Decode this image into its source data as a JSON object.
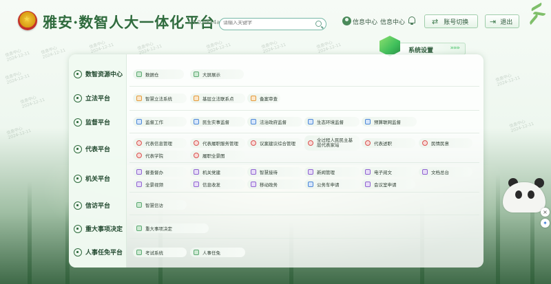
{
  "header": {
    "title": "雅安·数智人大一体化平台",
    "version": "v5.0.0814a",
    "search_placeholder": "请输入关键字",
    "user_link": "信息中心",
    "info_center": "信息中心",
    "switch_account": "账号切换",
    "logout": "退出"
  },
  "system_settings": {
    "label": "系统设置",
    "arrows": "»»»"
  },
  "watermark": {
    "line1": "信息中心",
    "line2": "2024-12-11"
  },
  "rows": [
    {
      "label": "数智资源中心",
      "items": [
        {
          "label": "数据仓",
          "icon": "database-icon",
          "color": "green"
        },
        {
          "label": "大屏展示",
          "icon": "screen-icon",
          "color": "green"
        }
      ]
    },
    {
      "label": "立法平台",
      "items": [
        {
          "label": "智慧立法系统",
          "icon": "legislation-icon",
          "color": "orange"
        },
        {
          "label": "基层立法联系点",
          "icon": "contact-point-icon",
          "color": "orange"
        },
        {
          "label": "备案审查",
          "icon": "review-icon",
          "color": "orange"
        }
      ]
    },
    {
      "label": "监督平台",
      "items": [
        {
          "label": "监督工作",
          "icon": "supervision-icon",
          "color": "blue"
        },
        {
          "label": "民生实事监督",
          "icon": "livelihood-icon",
          "color": "blue"
        },
        {
          "label": "法治政府监督",
          "icon": "rule-of-law-icon",
          "color": "blue"
        },
        {
          "label": "生态环境监督",
          "icon": "ecology-icon",
          "color": "blue"
        },
        {
          "label": "预算联网监督",
          "icon": "budget-icon",
          "color": "blue"
        }
      ]
    },
    {
      "label": "代表平台",
      "items": [
        {
          "label": "代表信息管理",
          "icon": "deputy-info-icon",
          "color": "red"
        },
        {
          "label": "代表履职服务管理",
          "icon": "duty-service-icon",
          "color": "red"
        },
        {
          "label": "议案建议综合管理",
          "icon": "proposal-icon",
          "color": "red"
        },
        {
          "label": "全过程人民民主基层代表家站",
          "icon": "home-station-icon",
          "color": "red"
        },
        {
          "label": "代表述职",
          "icon": "report-icon",
          "color": "red"
        },
        {
          "label": "民情民意",
          "icon": "opinion-icon",
          "color": "red"
        },
        {
          "label": "代表学院",
          "icon": "academy-icon",
          "color": "red"
        },
        {
          "label": "履职全景图",
          "icon": "panorama-icon",
          "color": "red"
        }
      ]
    },
    {
      "label": "机关平台",
      "items": [
        {
          "label": "督查督办",
          "icon": "inspection-icon",
          "color": "purple"
        },
        {
          "label": "机关党建",
          "icon": "party-building-icon",
          "color": "purple"
        },
        {
          "label": "智慧接待",
          "icon": "reception-icon",
          "color": "purple"
        },
        {
          "label": "新闻管理",
          "icon": "news-icon",
          "color": "purple"
        },
        {
          "label": "电子阅文",
          "icon": "e-document-icon",
          "color": "purple"
        },
        {
          "label": "文档总台",
          "icon": "archive-icon",
          "color": "purple"
        },
        {
          "label": "全景视频",
          "icon": "video-icon",
          "color": "purple"
        },
        {
          "label": "信息收发",
          "icon": "message-icon",
          "color": "purple"
        },
        {
          "label": "移动政务",
          "icon": "mobile-icon",
          "color": "purple"
        },
        {
          "label": "公务车申请",
          "icon": "car-icon",
          "color": "blue"
        },
        {
          "label": "会议室申请",
          "icon": "meeting-room-icon",
          "color": "purple"
        }
      ]
    },
    {
      "label": "信访平台",
      "items": [
        {
          "label": "智慧信访",
          "icon": "petition-icon",
          "color": "green"
        }
      ]
    },
    {
      "label": "重大事项决定",
      "items": [
        {
          "label": "重大事项决定",
          "icon": "major-matter-icon",
          "color": "green"
        }
      ]
    },
    {
      "label": "人事任免平台",
      "items": [
        {
          "label": "考试系统",
          "icon": "exam-icon",
          "color": "green"
        },
        {
          "label": "人事任免",
          "icon": "appointment-icon",
          "color": "green"
        }
      ]
    }
  ]
}
